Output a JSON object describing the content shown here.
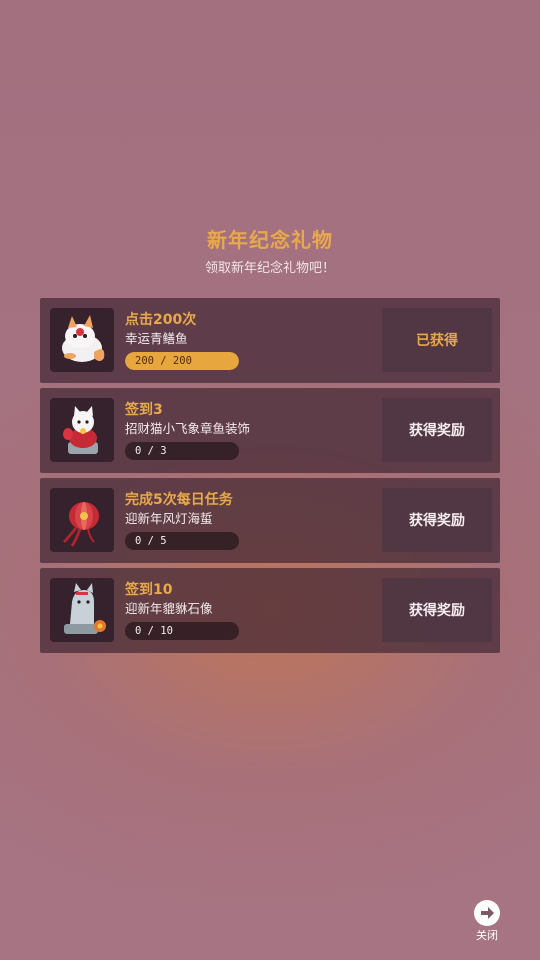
{
  "header": {
    "title": "新年纪念礼物",
    "subtitle": "领取新年纪念礼物吧！"
  },
  "items": [
    {
      "task": "点击200次",
      "reward": "幸运青鳝鱼",
      "progress_text": "200 / 200",
      "progress_fraction": 1.0,
      "action": "已获得",
      "claimed": true,
      "icon": "fox-fish-icon"
    },
    {
      "task": "签到3",
      "reward": "招财猫小飞象章鱼装饰",
      "progress_text": "0 / 3",
      "progress_fraction": 0,
      "action": "获得奖励",
      "claimed": false,
      "icon": "lucky-cat-icon"
    },
    {
      "task": "完成5次每日任务",
      "reward": "迎新年风灯海蜇",
      "progress_text": "0 / 5",
      "progress_fraction": 0,
      "action": "获得奖励",
      "claimed": false,
      "icon": "lantern-icon"
    },
    {
      "task": "签到10",
      "reward": "迎新年貔貅石像",
      "progress_text": "0 / 10",
      "progress_fraction": 0,
      "action": "获得奖励",
      "claimed": false,
      "icon": "pixiu-statue-icon"
    }
  ],
  "close": {
    "label": "关闭",
    "icon": "arrow-right-icon"
  },
  "colors": {
    "accent": "#e9a94a",
    "row_bg": "#42283a",
    "button_bg": "#50364a"
  }
}
